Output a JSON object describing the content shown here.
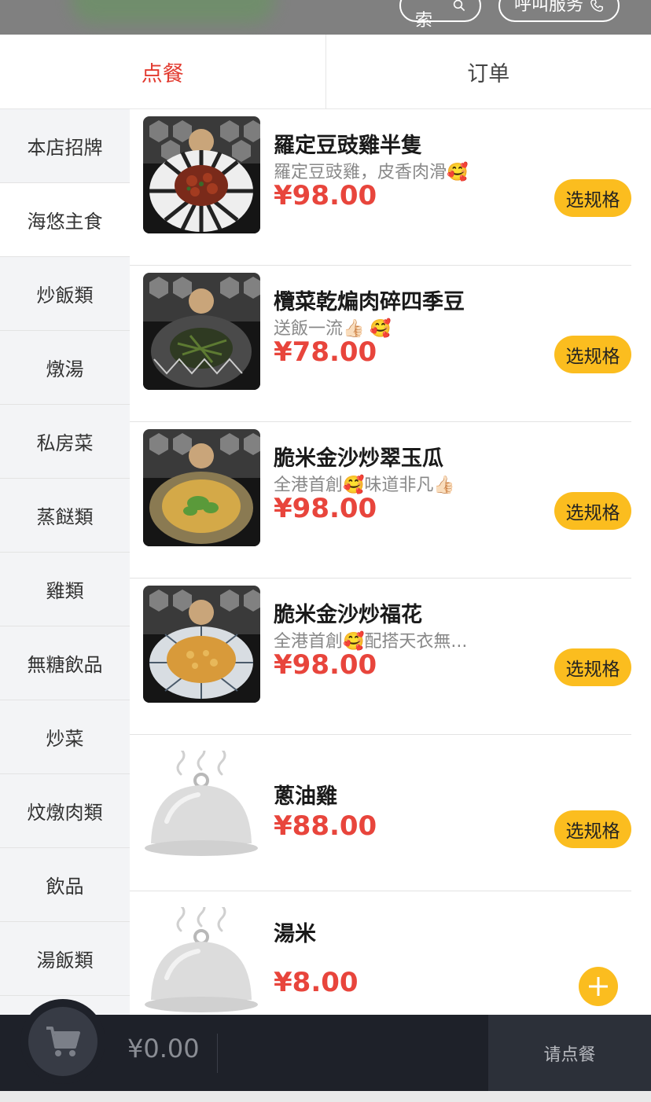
{
  "header": {
    "search_label": "搜索",
    "call_label": "呼叫服务"
  },
  "tabs": [
    {
      "label": "点餐",
      "active": true
    },
    {
      "label": "订单",
      "active": false
    }
  ],
  "sidebar": {
    "items": [
      {
        "label": "本店招牌"
      },
      {
        "label": "海悠主食",
        "active": true
      },
      {
        "label": "炒飯類"
      },
      {
        "label": "燉湯"
      },
      {
        "label": "私房菜"
      },
      {
        "label": "蒸餸類"
      },
      {
        "label": "雞類"
      },
      {
        "label": "無糖飲品"
      },
      {
        "label": "炒菜"
      },
      {
        "label": "炆燉肉類"
      },
      {
        "label": "飲品"
      },
      {
        "label": "湯飯類"
      }
    ]
  },
  "menu": {
    "items": [
      {
        "name": "羅定豆豉雞半隻",
        "desc": "羅定豆豉雞，皮香肉滑🥰",
        "price": "¥98.00",
        "action": "选规格",
        "image": "dish-photo"
      },
      {
        "name": "欖菜乾煸肉碎四季豆",
        "desc": "送飯一流👍🏻 🥰",
        "price": "¥78.00",
        "action": "选规格",
        "image": "dish-photo"
      },
      {
        "name": "脆米金沙炒翠玉瓜",
        "desc": "全港首創🥰味道非凡👍🏻",
        "price": "¥98.00",
        "action": "选规格",
        "image": "dish-photo"
      },
      {
        "name": "脆米金沙炒福花",
        "desc": "全港首創🥰配搭天衣無...",
        "price": "¥98.00",
        "action": "选规格",
        "image": "dish-photo"
      },
      {
        "name": "蔥油雞",
        "desc": "",
        "price": "¥88.00",
        "action": "选规格",
        "image": "placeholder-cloche"
      },
      {
        "name": "湯米",
        "desc": "",
        "price": "¥8.00",
        "action": "+",
        "image": "placeholder-cloche"
      }
    ]
  },
  "cart": {
    "total": "¥0.00",
    "order_label": "请点餐",
    "icon": "cart-icon"
  },
  "colors": {
    "accent_red": "#e23b30",
    "price_red": "#e8453c",
    "button_yellow": "#fbbd1f",
    "bottom_bar": "#1e2129"
  }
}
